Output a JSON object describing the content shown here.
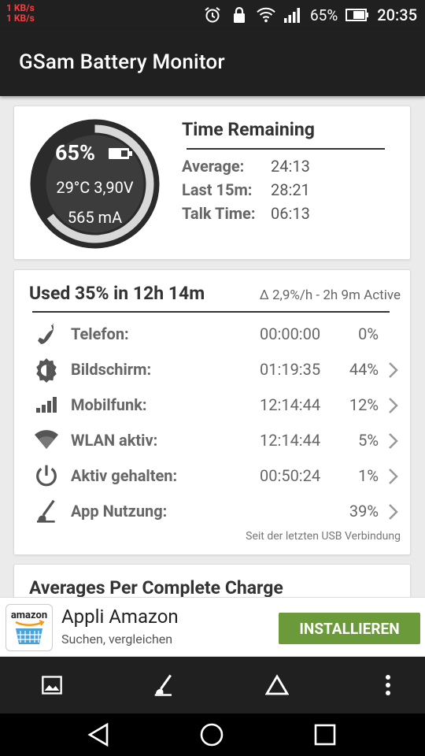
{
  "status": {
    "net_up": "1 KB/s",
    "net_down": "1 KB/s",
    "battery_text": "65%",
    "time": "20:35",
    "icons": [
      "alarm-icon",
      "lock-icon",
      "wifi-icon",
      "signal-icon",
      "battery-icon"
    ]
  },
  "app": {
    "title": "GSam Battery Monitor"
  },
  "gauge": {
    "percent": "65%",
    "percent_value": 0.65,
    "temp_voltage": "29°C  3,90V",
    "current": "565 mA",
    "colors": {
      "ring": "#2b2b2b",
      "arc": "#d8d8d8",
      "inner": "#3c3c3c"
    }
  },
  "time_remaining": {
    "title": "Time Remaining",
    "rows": [
      {
        "label": "Average:",
        "value": "24:13"
      },
      {
        "label": "Last 15m:",
        "value": "28:21"
      },
      {
        "label": "Talk Time:",
        "value": "06:13"
      }
    ]
  },
  "usage": {
    "title": "Used 35% in 12h 14m",
    "rate": "∆ 2,9%/h - 2h 9m Active",
    "rows": [
      {
        "icon": "phone-icon",
        "label": "Telefon:",
        "time": "00:00:00",
        "pct": "0%",
        "chevron": false
      },
      {
        "icon": "brightness-icon",
        "label": "Bildschirm:",
        "time": "01:19:35",
        "pct": "44%",
        "chevron": true
      },
      {
        "icon": "signal-bars-icon",
        "label": "Mobilfunk:",
        "time": "12:14:44",
        "pct": "12%",
        "chevron": true
      },
      {
        "icon": "wifi-icon",
        "label": "WLAN aktiv:",
        "time": "12:14:44",
        "pct": "5%",
        "chevron": true
      },
      {
        "icon": "power-icon",
        "label": "Aktiv gehalten:",
        "time": "00:50:24",
        "pct": "1%",
        "chevron": true
      },
      {
        "icon": "app-usage-icon",
        "label": "App Nutzung:",
        "time": "",
        "pct": "39%",
        "chevron": true
      }
    ],
    "footnote": "Seit der letzten USB Verbindung"
  },
  "averages": {
    "title": "Averages Per Complete Charge"
  },
  "ad": {
    "logo_text": "amazon",
    "title": "Appli Amazon",
    "subtitle": "Suchen, vergleichen",
    "button": "INSTALLIEREN",
    "button_color": "#6a9a3a"
  },
  "bottom_bar": [
    "image-icon",
    "app-usage-icon",
    "triangle-icon",
    "overflow-menu-icon"
  ],
  "nav": [
    "back-icon",
    "home-icon",
    "recents-icon"
  ]
}
